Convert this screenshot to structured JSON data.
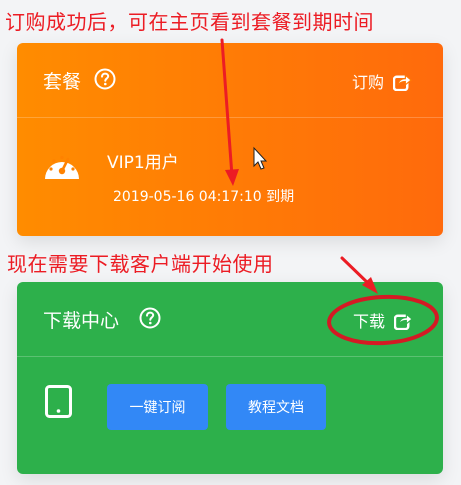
{
  "annotations": {
    "top_note": "订购成功后，可在主页看到套餐到期时间",
    "middle_note": "现在需要下载客户端开始使用"
  },
  "subscription_card": {
    "title": "套餐",
    "action_label": "订购",
    "plan_name": "VIP1用户",
    "expiry_date": "2019-05-16 04:17:10",
    "expiry_suffix": "到期",
    "gradient_colors": [
      "#ff8c00",
      "#ff6a0c"
    ]
  },
  "download_card": {
    "title": "下载中心",
    "action_label": "下载",
    "buttons": [
      {
        "label": "一键订阅"
      },
      {
        "label": "教程文档"
      }
    ],
    "background_color": "#2db04b",
    "button_color": "#3288f6"
  },
  "icons": {
    "help": "question-circle-icon",
    "share": "external-share-icon",
    "plan": "speedometer-icon",
    "device": "tablet-icon"
  },
  "annotation_color": "#ec1c24"
}
